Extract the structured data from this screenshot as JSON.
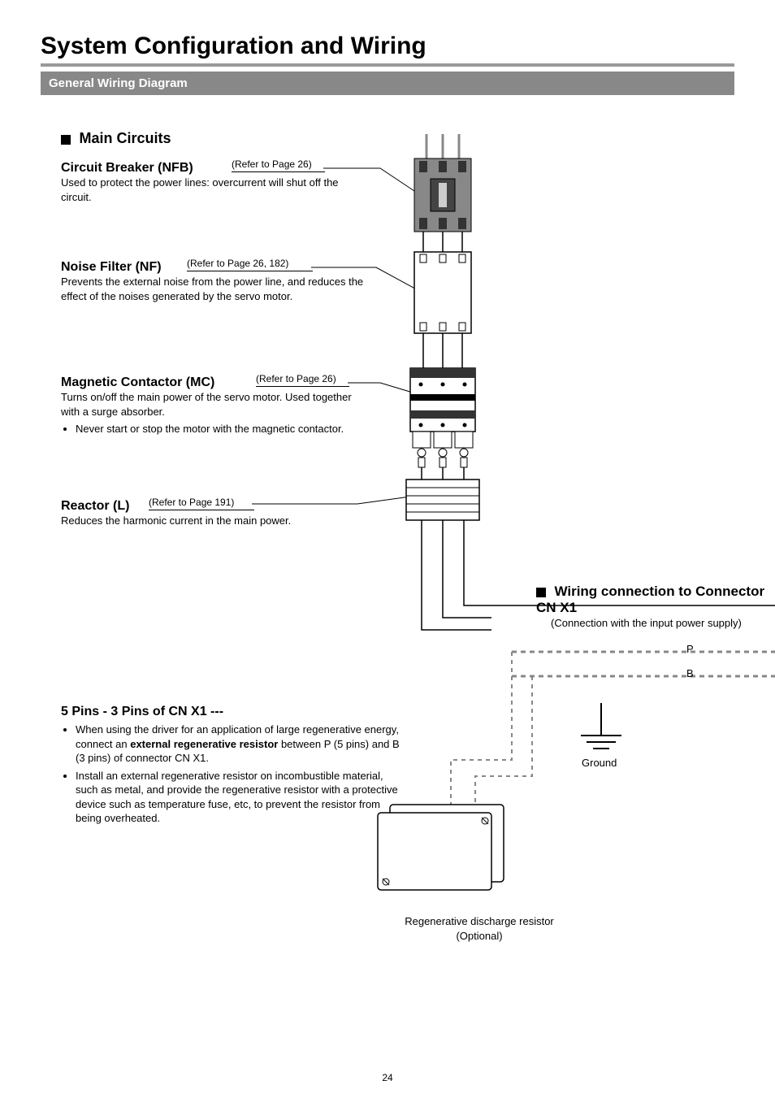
{
  "page_number": "24",
  "title": "System Configuration and Wiring",
  "section_bar": "General Wiring Diagram",
  "main_circuits": {
    "heading": "Main Circuits",
    "circuit_breaker": {
      "title": "Circuit Breaker (NFB)",
      "ref": "(Refer to Page 26)",
      "desc": "Used to protect the power lines: overcurrent will shut off the circuit."
    },
    "noise_filter": {
      "title": "Noise Filter (NF)",
      "ref": "(Refer to Page 26, 182)",
      "desc": "Prevents the external noise from the power line, and reduces the effect of the noises generated by the servo motor."
    },
    "magnetic_contactor": {
      "title": "Magnetic Contactor (MC)",
      "ref": "(Refer to Page 26)",
      "desc": "Turns on/off the main power of the servo motor. Used together with a surge absorber.",
      "bullet": "Never start or stop the motor with the magnetic contactor."
    },
    "reactor": {
      "title": "Reactor (L)",
      "ref": "(Refer to Page 191)",
      "desc": "Reduces the harmonic current in the main power."
    }
  },
  "pins_section": {
    "title": "5 Pins - 3 Pins of CN X1 ---",
    "bullets": [
      "When using the driver for an application of large regenerative energy, connect an external regenerative resistor between P (5 pins) and B (3 pins) of connector CN X1.",
      "Install an external regenerative resistor on incombustible material, such as metal, and provide the regenerative resistor with a protective device such as temperature fuse, etc, to prevent the resistor from being overheated."
    ],
    "bold_phrase": "external regenerative resistor"
  },
  "cnx1": {
    "heading": "Wiring connection to Connector CN X1",
    "sub": "(Connection with the input power supply)"
  },
  "labels": {
    "P": "P",
    "B": "B",
    "ground": "Ground",
    "regen_line1": "Regenerative discharge resistor",
    "regen_line2": "(Optional)"
  }
}
